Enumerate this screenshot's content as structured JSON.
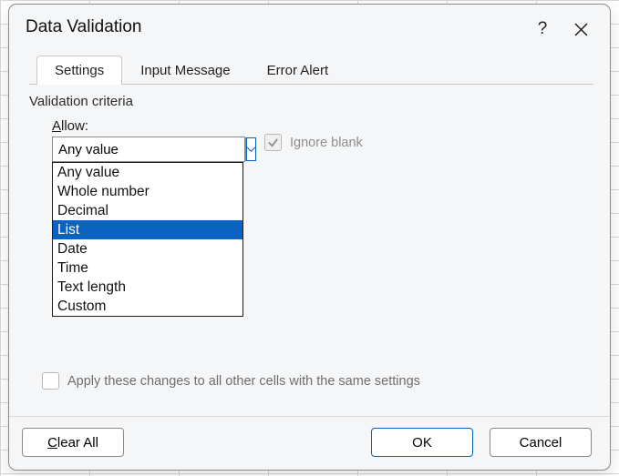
{
  "dialog": {
    "title": "Data Validation",
    "help_tooltip": "?",
    "tabs": [
      {
        "label": "Settings"
      },
      {
        "label": "Input Message"
      },
      {
        "label": "Error Alert"
      }
    ],
    "section_label": "Validation criteria",
    "allow": {
      "label_prefix": "A",
      "label_rest": "llow:",
      "value": "Any value",
      "options": [
        "Any value",
        "Whole number",
        "Decimal",
        "List",
        "Date",
        "Time",
        "Text length",
        "Custom"
      ],
      "highlighted_index": 3
    },
    "ignore_blank": {
      "label": "Ignore blank",
      "checked": true,
      "enabled": false
    },
    "apply_others": {
      "label": "Apply these changes to all other cells with the same settings",
      "checked": false,
      "enabled": false
    },
    "buttons": {
      "clear_prefix": "C",
      "clear_rest": "lear All",
      "ok": "OK",
      "cancel": "Cancel"
    }
  }
}
